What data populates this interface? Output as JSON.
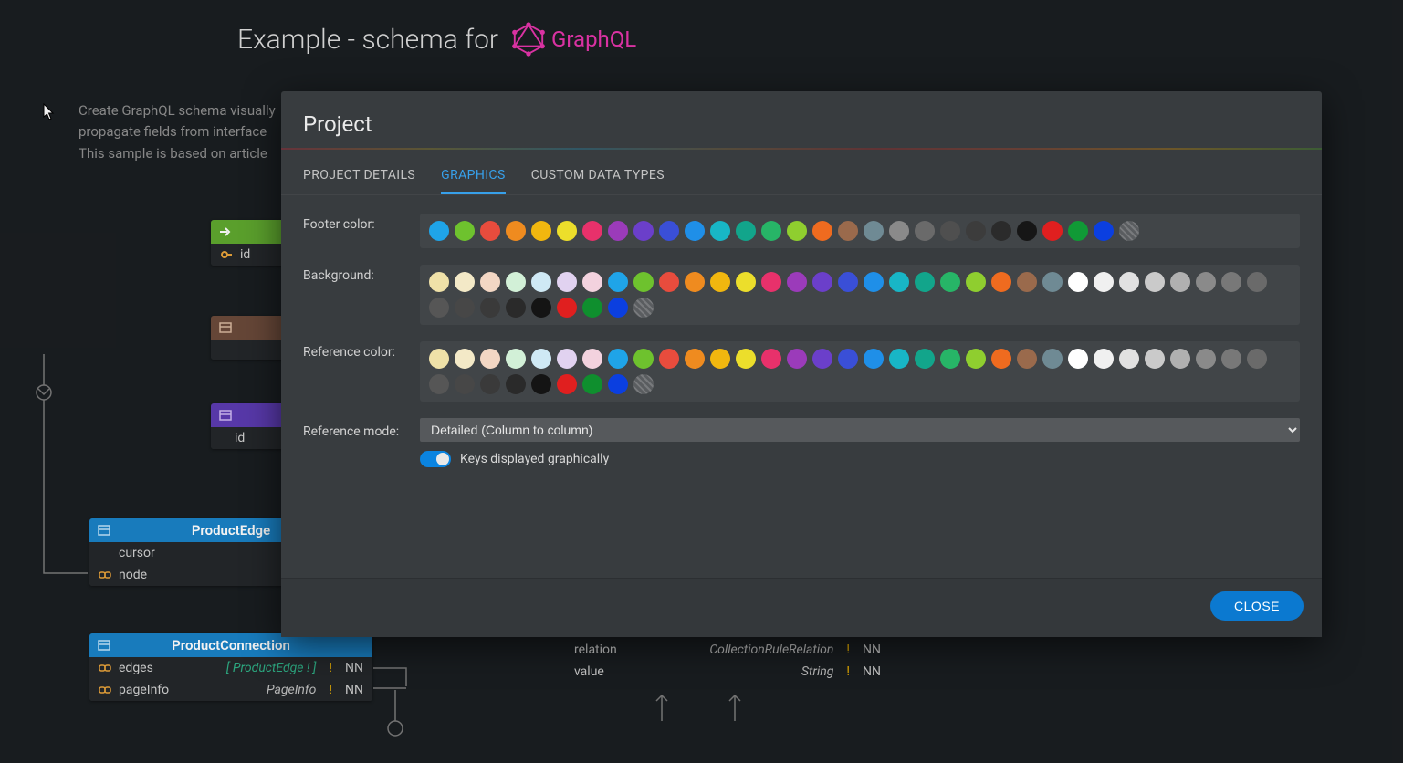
{
  "page": {
    "title": "Example - schema for",
    "brand": "GraphQL",
    "desc_line1": "Create GraphQL schema visually",
    "desc_line2": "propagate fields from interface",
    "desc_line3": "This sample is based on article"
  },
  "entities": {
    "green": {
      "field1": "id"
    },
    "purple": {
      "field1": "id"
    },
    "productEdge": {
      "title": "ProductEdge",
      "rows": [
        {
          "name": "cursor"
        },
        {
          "name": "node"
        }
      ]
    },
    "productConnection": {
      "title": "ProductConnection",
      "rows": [
        {
          "name": "edges",
          "type": "[ ProductEdge ! ]",
          "excl": "!",
          "nn": "NN"
        },
        {
          "name": "pageInfo",
          "type": "PageInfo",
          "excl": "!",
          "nn": "NN"
        }
      ]
    },
    "collectionRule": {
      "rows": [
        {
          "name": "relation",
          "type": "CollectionRuleRelation",
          "excl": "!",
          "nn": "NN"
        },
        {
          "name": "value",
          "type": "String",
          "excl": "!",
          "nn": "NN"
        }
      ]
    }
  },
  "modal": {
    "title": "Project",
    "tabs": [
      "PROJECT DETAILS",
      "GRAPHICS",
      "CUSTOM DATA TYPES"
    ],
    "active_tab": 1,
    "labels": {
      "footer": "Footer color:",
      "background": "Background:",
      "reference": "Reference color:",
      "ref_mode": "Reference mode:",
      "keys_toggle": "Keys displayed graphically"
    },
    "ref_mode_value": "Detailed (Column to column)",
    "close": "CLOSE",
    "footer_colors": [
      "#1fa4e8",
      "#6ec22e",
      "#e84c3d",
      "#ef8b1f",
      "#f1b70f",
      "#ecde2b",
      "#e8316b",
      "#9b3bba",
      "#6b3fca",
      "#3a4fd7",
      "#1f8fe8",
      "#18b6c6",
      "#12a58b",
      "#27b567",
      "#8fce2f",
      "#ef6b1f",
      "#9a6a4c",
      "#6f8a94",
      "#8a8a8a",
      "#6a6a6a",
      "#4f4f4f",
      "#3c3c3c",
      "#2b2b2b",
      "#161616",
      "#e01f1f",
      "#109a36",
      "#0b3fe0"
    ],
    "footer_hatched": [
      true
    ],
    "background_colors": [
      "#efe1a8",
      "#f3e9c7",
      "#f3d7c4",
      "#d2f0d7",
      "#cfe9f5",
      "#e1d2f0",
      "#f3d2de",
      "#1fa4e8",
      "#6ec22e",
      "#e84c3d",
      "#ef8b1f",
      "#f1b70f",
      "#ecde2b",
      "#e8316b",
      "#9b3bba",
      "#6b3fca",
      "#3a4fd7",
      "#1f8fe8",
      "#18b6c6",
      "#12a58b",
      "#27b567",
      "#8fce2f",
      "#ef6b1f",
      "#9a6a4c",
      "#6f8a94",
      "#ffffff",
      "#f0f0f0",
      "#e1e1e1",
      "#cacaca",
      "#b0b0b0",
      "#8a8a8a",
      "#787878",
      "#6a6a6a",
      "#565656",
      "#474747",
      "#3a3a3a",
      "#2a2a2a",
      "#141414",
      "#e01f1f",
      "#0f8f2e",
      "#0b3fe0"
    ],
    "background_hatched": [
      true
    ],
    "reference_colors": [
      "#efe1a8",
      "#f3e9c7",
      "#f3d7c4",
      "#d2f0d7",
      "#cfe9f5",
      "#e1d2f0",
      "#f3d2de",
      "#1fa4e8",
      "#6ec22e",
      "#e84c3d",
      "#ef8b1f",
      "#f1b70f",
      "#ecde2b",
      "#e8316b",
      "#9b3bba",
      "#6b3fca",
      "#3a4fd7",
      "#1f8fe8",
      "#18b6c6",
      "#12a58b",
      "#27b567",
      "#8fce2f",
      "#ef6b1f",
      "#9a6a4c",
      "#6f8a94",
      "#ffffff",
      "#f0f0f0",
      "#e1e1e1",
      "#cacaca",
      "#b0b0b0",
      "#8a8a8a",
      "#787878",
      "#6a6a6a",
      "#565656",
      "#474747",
      "#3a3a3a",
      "#2a2a2a",
      "#141414",
      "#e01f1f",
      "#0f8f2e",
      "#0b3fe0"
    ],
    "reference_hatched": [
      true
    ]
  }
}
